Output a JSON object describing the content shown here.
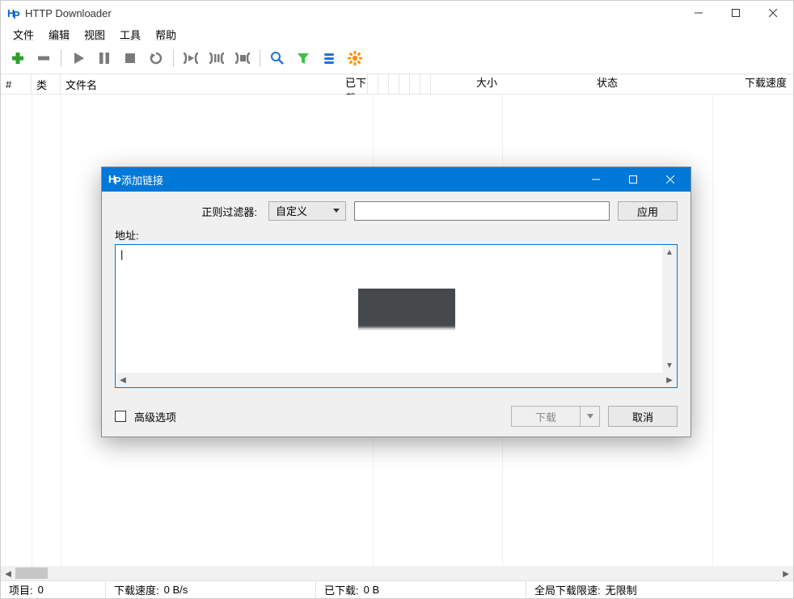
{
  "app": {
    "title": "HTTP Downloader"
  },
  "menu": {
    "file": "文件",
    "edit": "编辑",
    "view": "视图",
    "tools": "工具",
    "help": "帮助"
  },
  "columns": {
    "num": "#",
    "type": "类",
    "filename": "文件名",
    "downloaded": "已下载",
    "size": "大小",
    "status": "状态",
    "speed": "下载速度"
  },
  "status": {
    "items_label": "项目:",
    "items_value": "0",
    "speed_label": "下载速度:",
    "speed_value": "0 B/s",
    "downloaded_label": "已下载:",
    "downloaded_value": "0 B",
    "limit_label": "全局下载限速:",
    "limit_value": "无限制"
  },
  "dialog": {
    "title": "添加链接",
    "filter_label": "正则过滤器:",
    "filter_preset": "自定义",
    "apply": "应用",
    "url_label": "地址:",
    "url_value": "",
    "advanced": "高级选项",
    "download": "下载",
    "cancel": "取消"
  },
  "icons": {
    "add": "add-icon",
    "remove": "remove-icon",
    "start": "play-icon",
    "pause": "pause-icon",
    "stop": "stop-icon",
    "restart": "restart-icon",
    "pause_inactive": "pause-idle-icon",
    "stop_inactive": "stop-idle-icon",
    "stop_all": "stop-all-icon",
    "search": "search-icon",
    "filter": "funnel-icon",
    "queue": "queue-icon",
    "settings": "gear-icon"
  }
}
